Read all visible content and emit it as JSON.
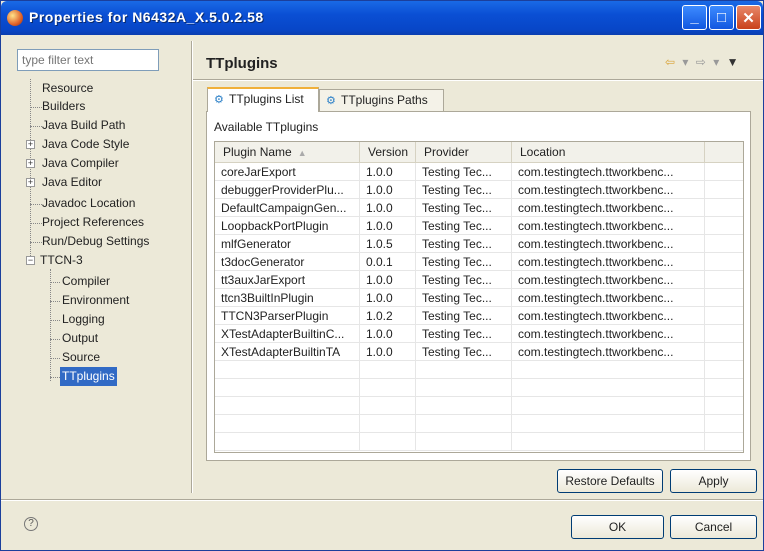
{
  "window": {
    "title": "Properties for N6432A_X.5.0.2.58",
    "minimize_label": "_",
    "maximize_label": "□",
    "close_label": "✕"
  },
  "sidebar": {
    "filter_placeholder": "type filter text",
    "items": [
      {
        "label": "Resource"
      },
      {
        "label": "Builders"
      },
      {
        "label": "Java Build Path"
      },
      {
        "label": "Java Code Style"
      },
      {
        "label": "Java Compiler"
      },
      {
        "label": "Java Editor"
      },
      {
        "label": "Javadoc Location"
      },
      {
        "label": "Project References"
      },
      {
        "label": "Run/Debug Settings"
      },
      {
        "label": "TTCN-3"
      },
      {
        "label": "Compiler"
      },
      {
        "label": "Environment"
      },
      {
        "label": "Logging"
      },
      {
        "label": "Output"
      },
      {
        "label": "Source"
      },
      {
        "label": "TTplugins"
      }
    ]
  },
  "page": {
    "title": "TTplugins",
    "nav_back_icon": "⇦",
    "nav_forward_icon": "⇨"
  },
  "tabs": [
    {
      "label": "TTplugins List",
      "active": true
    },
    {
      "label": "TTplugins Paths",
      "active": false
    }
  ],
  "table": {
    "section_label": "Available TTplugins",
    "columns": [
      "Plugin Name",
      "Version",
      "Provider",
      "Location"
    ],
    "rows": [
      [
        "coreJarExport",
        "1.0.0",
        "Testing Tec...",
        "com.testingtech.ttworkbenc..."
      ],
      [
        "debuggerProviderPlu...",
        "1.0.0",
        "Testing Tec...",
        "com.testingtech.ttworkbenc..."
      ],
      [
        "DefaultCampaignGen...",
        "1.0.0",
        "Testing Tec...",
        "com.testingtech.ttworkbenc..."
      ],
      [
        "LoopbackPortPlugin",
        "1.0.0",
        "Testing Tec...",
        "com.testingtech.ttworkbenc..."
      ],
      [
        "mlfGenerator",
        "1.0.5",
        "Testing Tec...",
        "com.testingtech.ttworkbenc..."
      ],
      [
        "t3docGenerator",
        "0.0.1",
        "Testing Tec...",
        "com.testingtech.ttworkbenc..."
      ],
      [
        "tt3auxJarExport",
        "1.0.0",
        "Testing Tec...",
        "com.testingtech.ttworkbenc..."
      ],
      [
        "ttcn3BuiltInPlugin",
        "1.0.0",
        "Testing Tec...",
        "com.testingtech.ttworkbenc..."
      ],
      [
        "TTCN3ParserPlugin",
        "1.0.2",
        "Testing Tec...",
        "com.testingtech.ttworkbenc..."
      ],
      [
        "XTestAdapterBuiltinC...",
        "1.0.0",
        "Testing Tec...",
        "com.testingtech.ttworkbenc..."
      ],
      [
        "XTestAdapterBuiltinTA",
        "1.0.0",
        "Testing Tec...",
        "com.testingtech.ttworkbenc..."
      ]
    ]
  },
  "buttons": {
    "restore_defaults": "Restore Defaults",
    "apply": "Apply",
    "ok": "OK",
    "cancel": "Cancel",
    "help_icon": "?"
  }
}
